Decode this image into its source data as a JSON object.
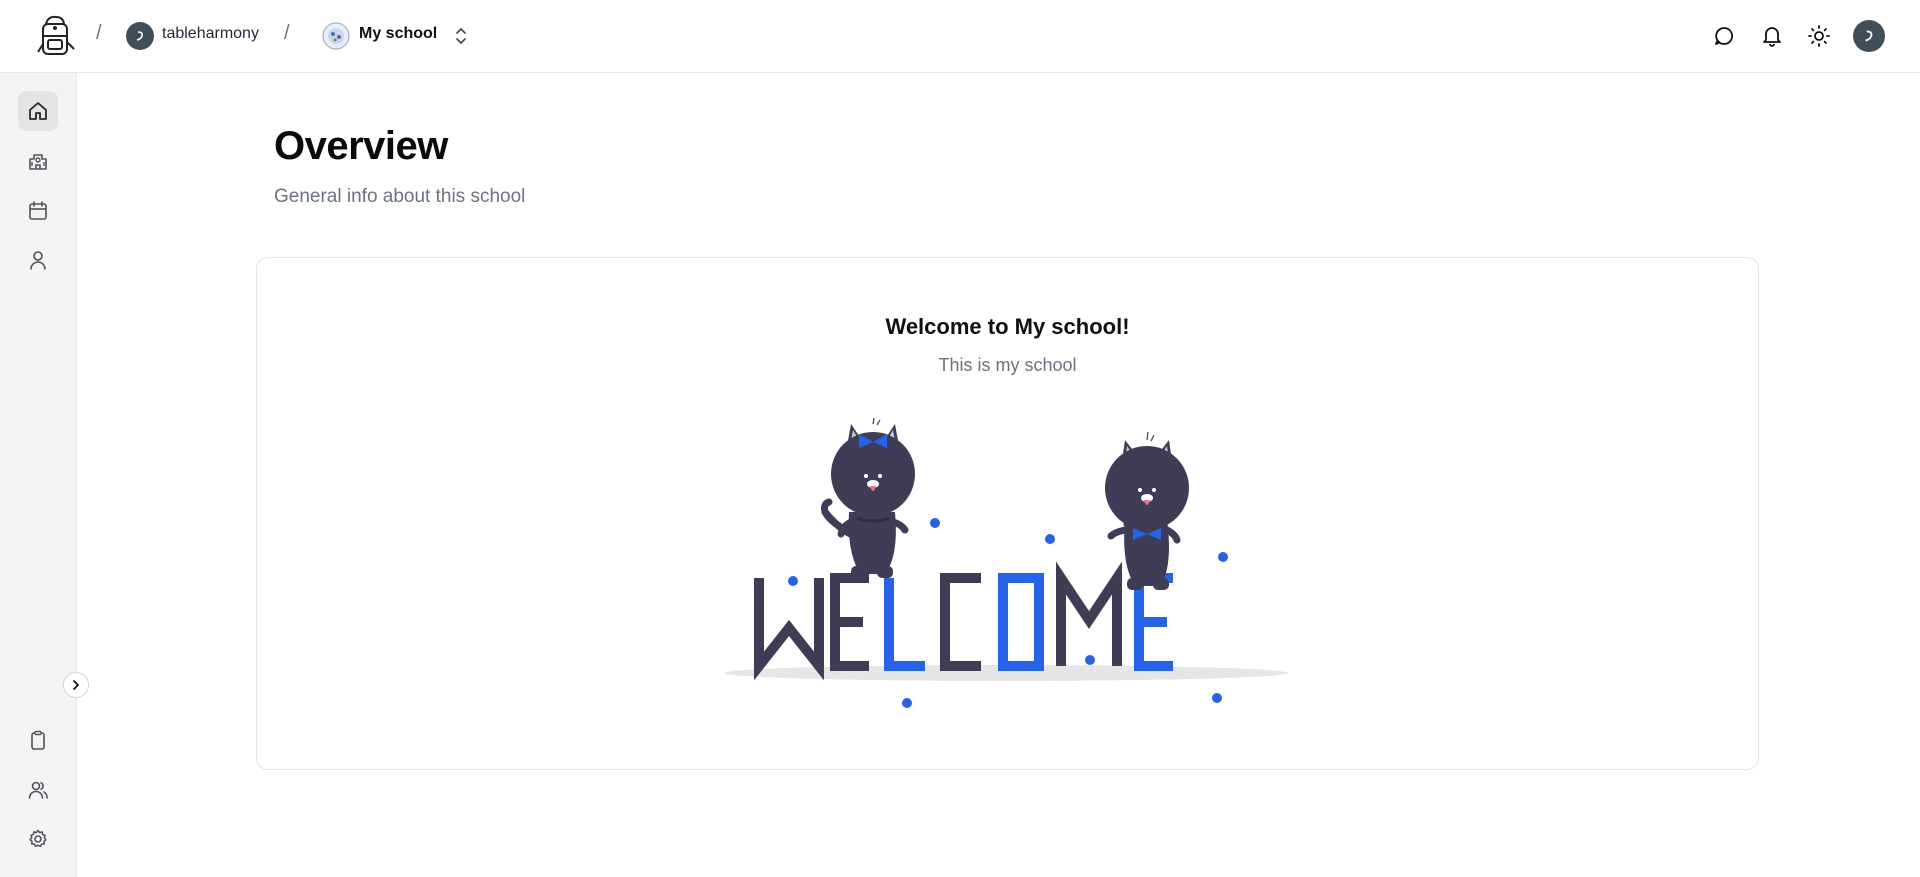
{
  "header": {
    "separator": "/",
    "breadcrumb_user": "tableharmony",
    "breadcrumb_school": "My school",
    "icons": [
      "logo-backpack-icon",
      "user-avatar-icon",
      "school-logo-icon",
      "chevron-up-down-icon",
      "chat-icon",
      "bell-icon",
      "sun-icon",
      "profile-avatar-icon"
    ]
  },
  "sidebar": {
    "top_items": [
      {
        "icon": "home-icon",
        "active": true
      },
      {
        "icon": "school-building-icon",
        "active": false
      },
      {
        "icon": "calendar-icon",
        "active": false
      },
      {
        "icon": "user-icon",
        "active": false
      }
    ],
    "bottom_items": [
      {
        "icon": "clipboard-icon"
      },
      {
        "icon": "users-icon"
      },
      {
        "icon": "settings-gear-icon"
      }
    ],
    "expand_icon": "chevron-right-icon"
  },
  "main": {
    "title": "Overview",
    "subtitle": "General info about this school",
    "card": {
      "title": "Welcome to My school!",
      "subtitle": "This is my school",
      "illustration": "welcome-cats-illustration"
    }
  },
  "colors": {
    "accent_blue": "#2563eb",
    "cat_dark": "#3f3d56",
    "avatar_bg": "#3f4f5a",
    "sidebar_bg": "#f4f4f5"
  }
}
